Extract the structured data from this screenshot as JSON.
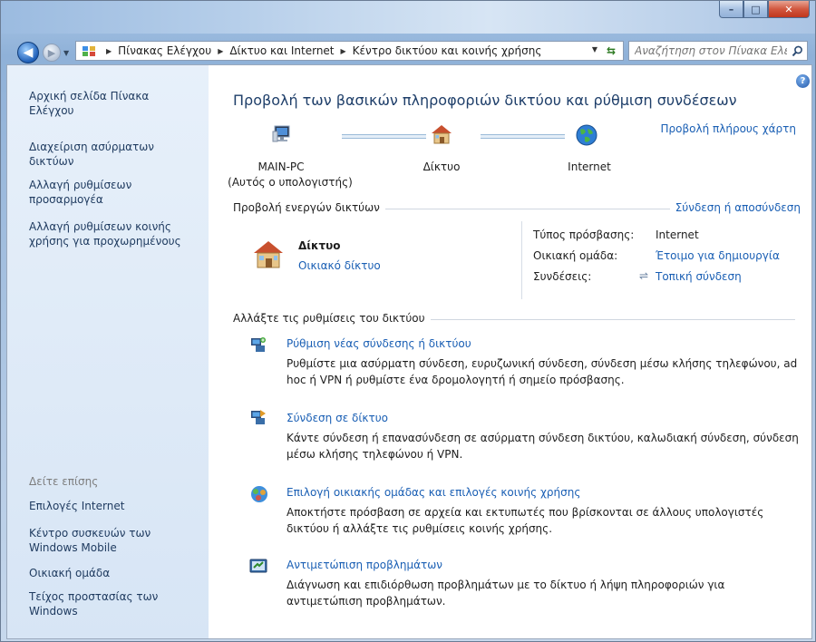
{
  "titlebar": {
    "minimize": "–",
    "maximize": "□",
    "close": "✕"
  },
  "addressbar": {
    "breadcrumbs": [
      "Πίνακας Ελέγχου",
      "Δίκτυο και Internet",
      "Κέντρο δικτύου και κοινής χρήσης"
    ],
    "search_placeholder": "Αναζήτηση στον Πίνακα Ελέ..."
  },
  "sidebar": {
    "tasks": [
      "Αρχική σελίδα Πίνακα Ελέγχου",
      "Διαχείριση ασύρματων δικτύων",
      "Αλλαγή ρυθμίσεων προσαρμογέα",
      "Αλλαγή ρυθμίσεων κοινής χρήσης για προχωρημένους"
    ],
    "see_also_heading": "Δείτε επίσης",
    "see_also": [
      "Επιλογές Internet",
      "Κέντρο συσκευών των Windows Mobile",
      "Οικιακή ομάδα",
      "Τείχος προστασίας των Windows"
    ]
  },
  "main": {
    "title": "Προβολή των βασικών πληροφοριών δικτύου και ρύθμιση συνδέσεων",
    "full_map_link": "Προβολή πλήρους χάρτη",
    "map": {
      "computer_name": "MAIN-PC",
      "computer_sub": "(Αυτός ο υπολογιστής)",
      "network": "Δίκτυο",
      "internet": "Internet"
    },
    "active_networks_label": "Προβολή ενεργών δικτύων",
    "connect_disconnect_link": "Σύνδεση ή αποσύνδεση",
    "active_network": {
      "name": "Δίκτυο",
      "type_link": "Οικιακό δίκτυο",
      "access_type_label": "Τύπος πρόσβασης:",
      "access_type_value": "Internet",
      "homegroup_label": "Οικιακή ομάδα:",
      "homegroup_link": "Έτοιμο για δημιουργία",
      "connections_label": "Συνδέσεις:",
      "connections_link": "Τοπική σύνδεση"
    },
    "change_settings_label": "Αλλάξτε τις ρυθμίσεις του δικτύου",
    "tasks": [
      {
        "title": "Ρύθμιση νέας σύνδεσης ή δικτύου",
        "desc": "Ρυθμίστε μια ασύρματη σύνδεση, ευρυζωνική σύνδεση,  σύνδεση μέσω κλήσης τηλεφώνου, ad hoc ή VPN ή ρυθμίστε ένα δρομολογητή ή σημείο πρόσβασης."
      },
      {
        "title": "Σύνδεση σε δίκτυο",
        "desc": "Κάντε σύνδεση ή επανασύνδεση σε ασύρματη σύνδεση δικτύου, καλωδιακή σύνδεση, σύνδεση μέσω κλήσης τηλεφώνου ή VPN."
      },
      {
        "title": "Επιλογή οικιακής ομάδας και επιλογές κοινής χρήσης",
        "desc": "Αποκτήστε πρόσβαση σε αρχεία και εκτυπωτές που βρίσκονται σε άλλους υπολογιστές δικτύου ή αλλάξτε τις ρυθμίσεις κοινής χρήσης."
      },
      {
        "title": "Αντιμετώπιση προβλημάτων",
        "desc": "Διάγνωση και επιδιόρθωση προβλημάτων με το δίκτυο ή λήψη πληροφοριών για αντιμετώπιση προβλημάτων."
      }
    ]
  },
  "colors": {
    "link": "#1a5fb4",
    "title": "#1f3f6a",
    "sidebar_bg": "#dfeaf7"
  }
}
